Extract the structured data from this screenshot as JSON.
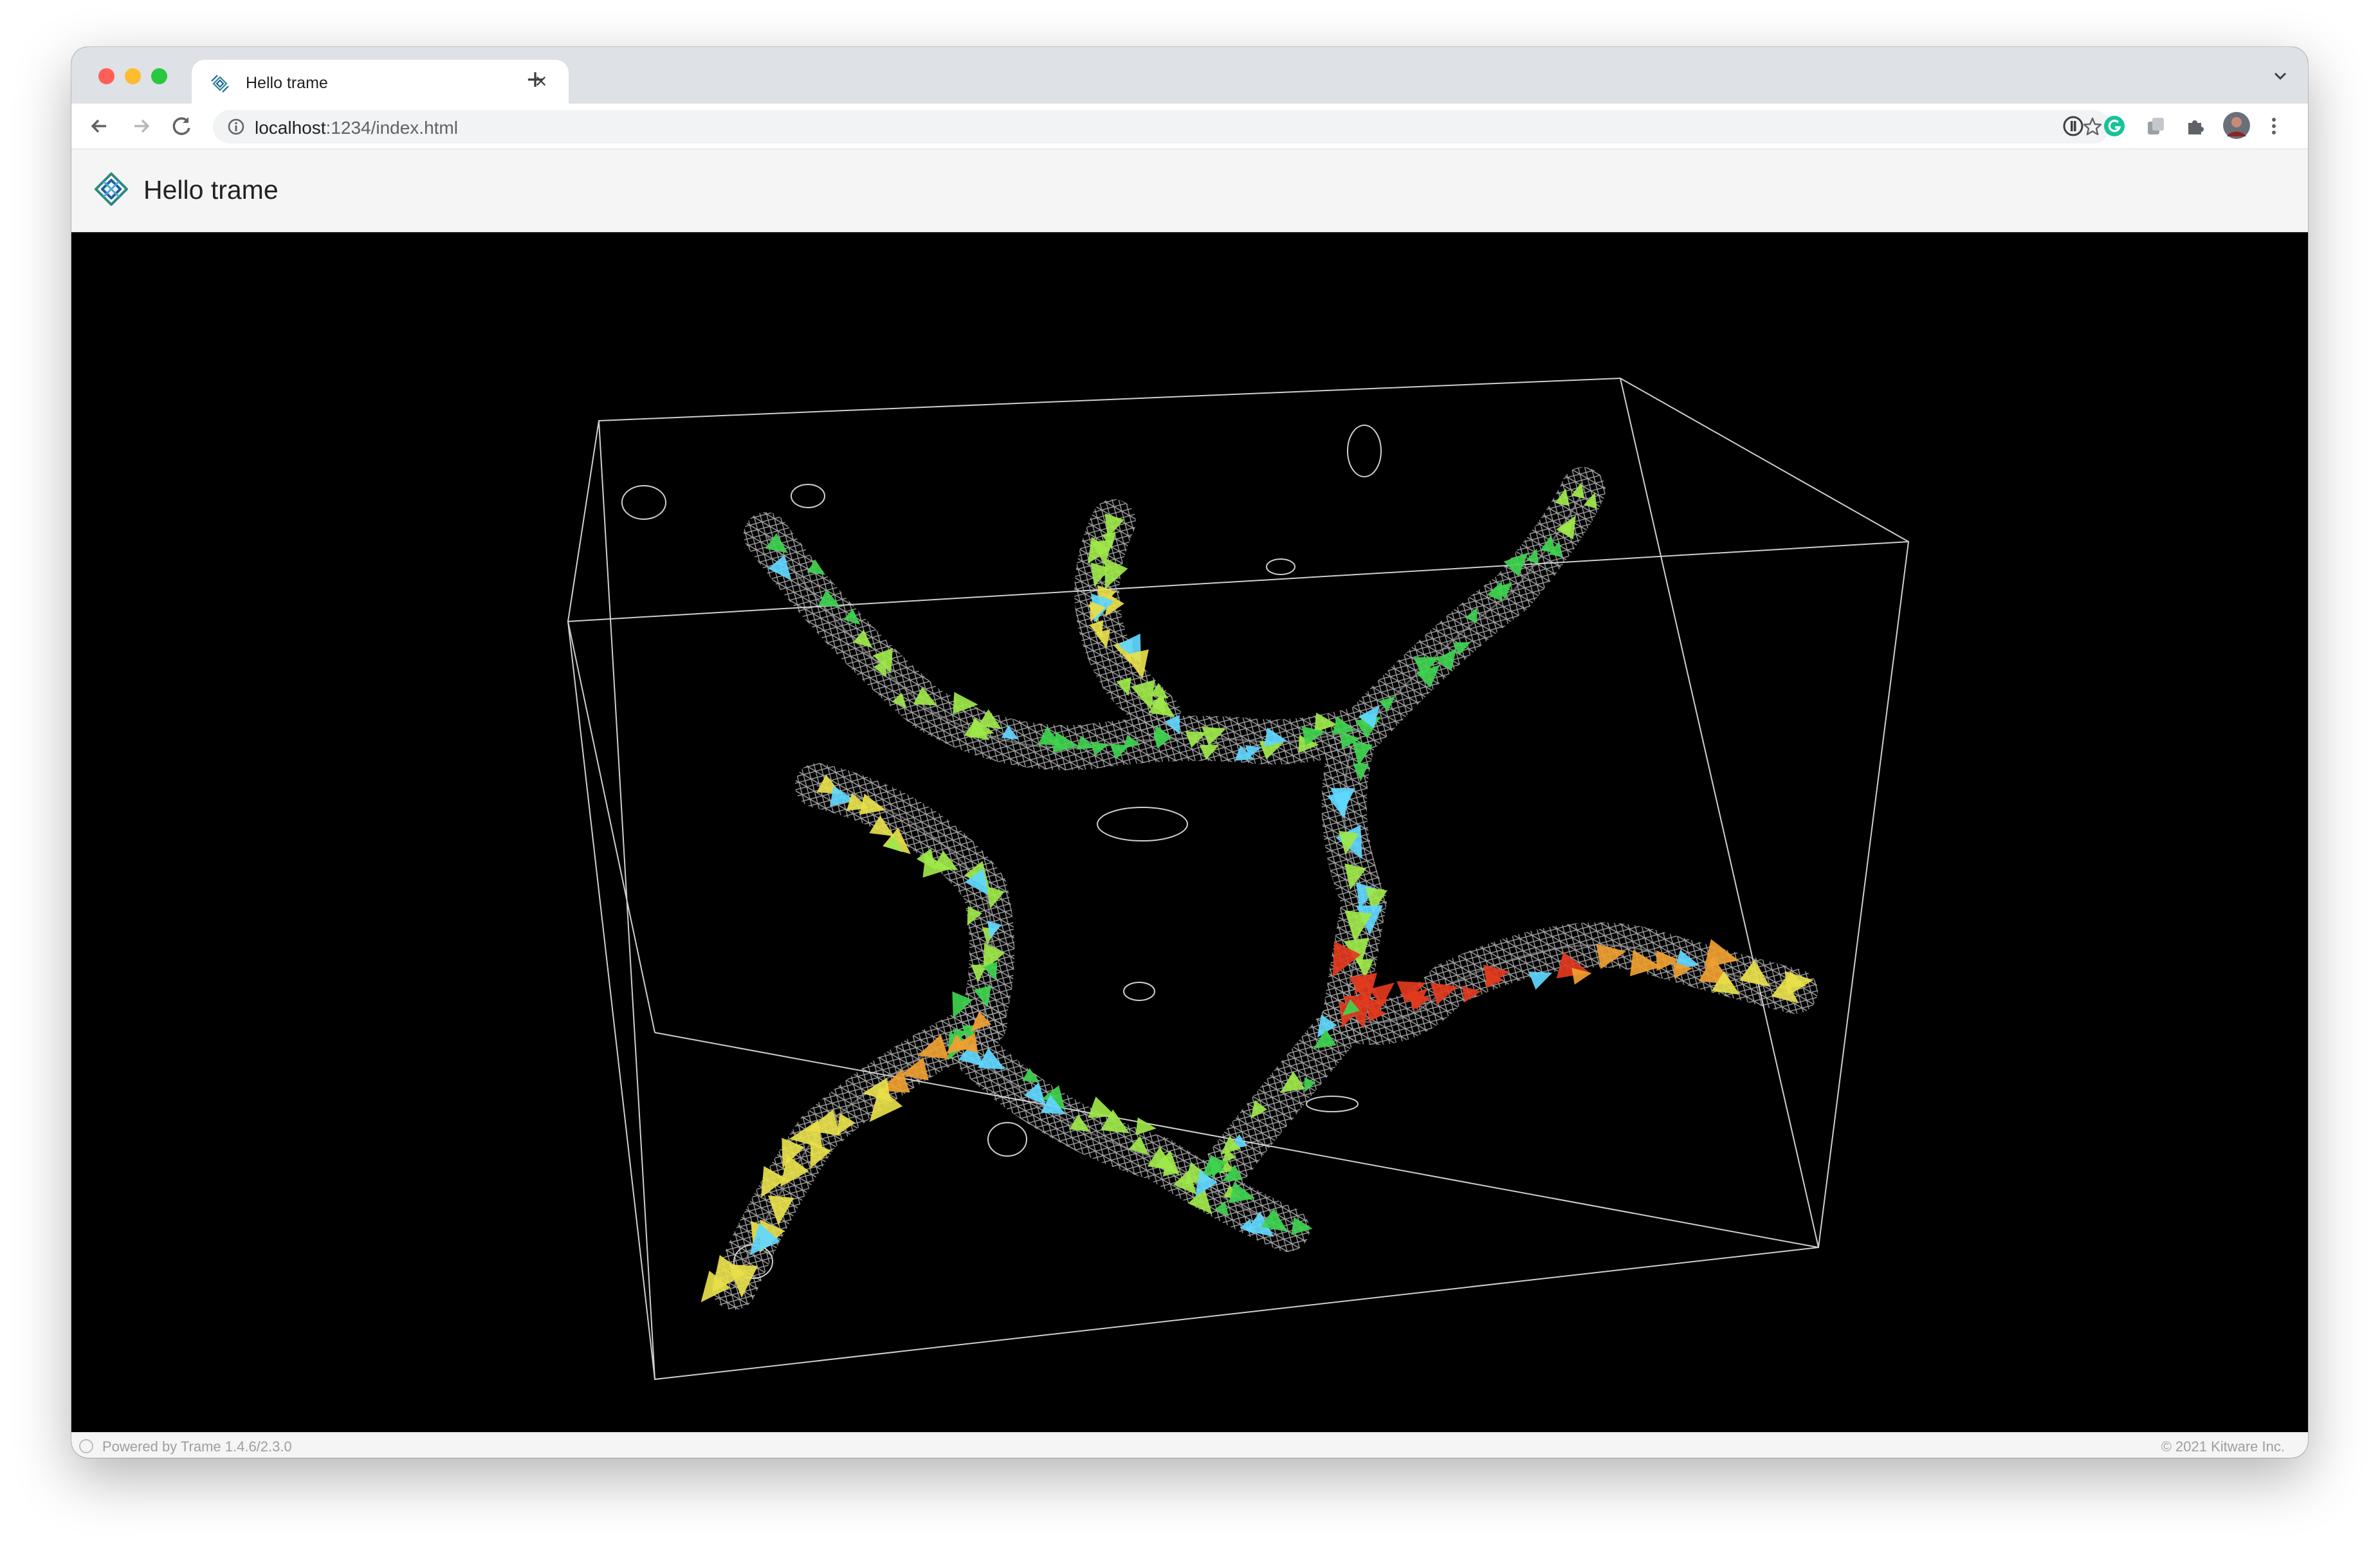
{
  "browser": {
    "tab": {
      "title": "Hello trame",
      "close_glyph": "×"
    },
    "new_tab_glyph": "+",
    "address": {
      "host": "localhost",
      "path": ":1234/index.html"
    },
    "icons": [
      "back-arrow-icon",
      "forward-arrow-icon",
      "reload-icon",
      "site-info-icon",
      "bookmark-star-icon",
      "password-manager-icon",
      "grammarly-icon",
      "extension-icon",
      "puzzle-icon",
      "profile-avatar",
      "kebab-menu-icon",
      "tab-list-chevron-icon"
    ]
  },
  "app": {
    "title": "Hello trame",
    "logo": "trame-logo-icon"
  },
  "scene": {
    "background": "#000000",
    "bounding_box_color": "#cfcfcf",
    "mesh_color": "#d9d9d9",
    "glyph_colors": [
      "#3fd44f",
      "#9ee84a",
      "#e8e04a",
      "#f0a030",
      "#e23a1e",
      "#5fd8ff"
    ]
  },
  "footer": {
    "left": "Powered by Trame 1.4.6/2.3.0",
    "right": "© 2021 Kitware Inc."
  }
}
